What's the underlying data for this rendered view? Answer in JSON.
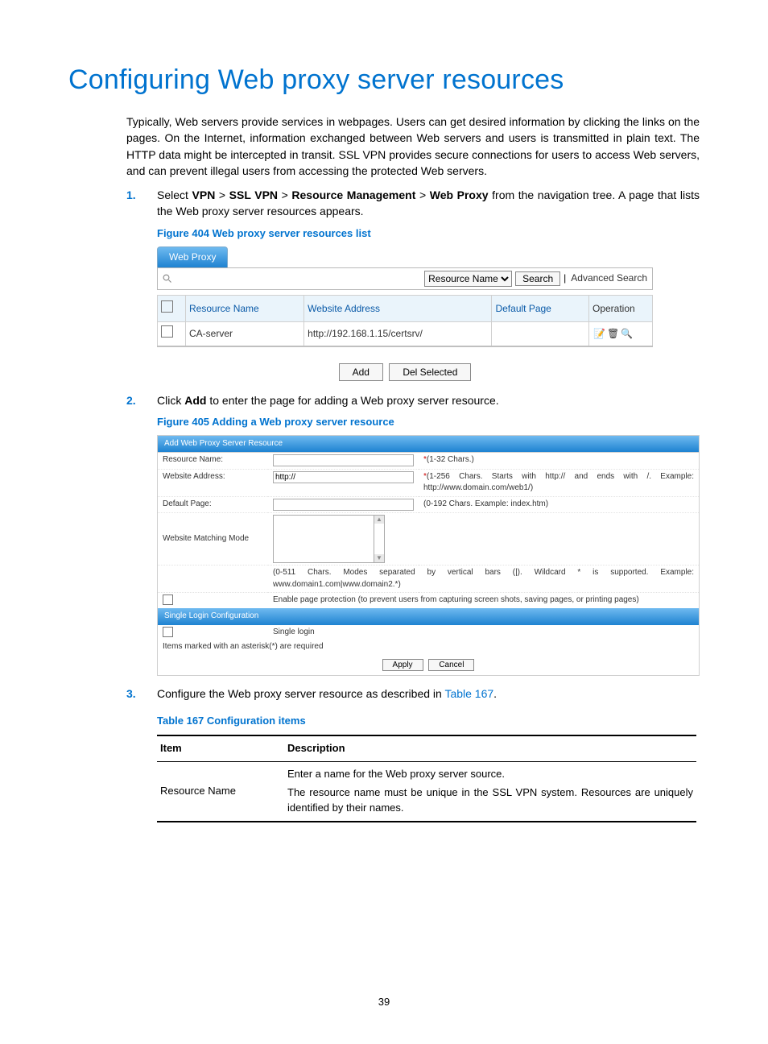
{
  "page": {
    "title": "Configuring Web proxy server resources",
    "intro": "Typically, Web servers provide services in webpages. Users can get desired information by clicking the links on the pages. On the Internet, information exchanged between Web servers and users is transmitted in plain text. The HTTP data might be intercepted in transit. SSL VPN provides secure connections for users to access Web servers, and can prevent illegal users from accessing the protected Web servers."
  },
  "step1": {
    "prefix": "Select ",
    "nav1": "VPN",
    "sep": " > ",
    "nav2": "SSL VPN",
    "nav3": "Resource Management",
    "nav4": "Web Proxy",
    "suffix": " from the navigation tree. A page that lists the Web proxy server resources appears."
  },
  "fig404": {
    "caption": "Figure 404 Web proxy server resources list",
    "tab": "Web Proxy",
    "filter_field": "Resource Name",
    "search_btn": "Search",
    "advanced": "Advanced Search",
    "cols": [
      "Resource Name",
      "Website Address",
      "Default Page",
      "Operation"
    ],
    "row": {
      "name": "CA-server",
      "addr": "http://192.168.1.15/certsrv/",
      "defpage": ""
    },
    "add_btn": "Add",
    "del_btn": "Del Selected"
  },
  "step2": {
    "prefix": "Click ",
    "bold": "Add",
    "suffix": " to enter the page for adding a Web proxy server resource."
  },
  "fig405": {
    "caption": "Figure 405 Adding a Web proxy server resource",
    "header": "Add Web Proxy Server Resource",
    "fields": {
      "resource_name": "Resource Name:",
      "resource_name_note": "(1-32 Chars.)",
      "website_addr": "Website Address:",
      "website_addr_val": "http://",
      "website_addr_note": "(1-256 Chars. Starts with http:// and ends with /. Example: http://www.domain.com/web1/)",
      "default_page": "Default Page:",
      "default_page_note": "(0-192 Chars. Example: index.htm)",
      "matching_mode": "Website Matching Mode",
      "matching_mode_note": "(0-511 Chars. Modes separated by vertical bars (|). Wildcard * is supported. Example: www.domain1.com|www.domain2.*)",
      "page_protect": "Enable page protection (to prevent users from capturing screen shots, saving pages, or printing pages)",
      "single_login_hdr": "Single Login Configuration",
      "single_login": "Single login",
      "required": "Items marked with an asterisk(*) are required",
      "apply": "Apply",
      "cancel": "Cancel"
    }
  },
  "step3": {
    "prefix": "Configure the Web proxy server resource as described in ",
    "ref": "Table 167",
    "suffix": "."
  },
  "table167": {
    "caption": "Table 167 Configuration items",
    "head_item": "Item",
    "head_desc": "Description",
    "row1_item": "Resource Name",
    "row1_desc1": "Enter a name for the Web proxy server source.",
    "row1_desc2": "The resource name must be unique in the SSL VPN system. Resources are uniquely identified by their names."
  },
  "pagenum": "39"
}
